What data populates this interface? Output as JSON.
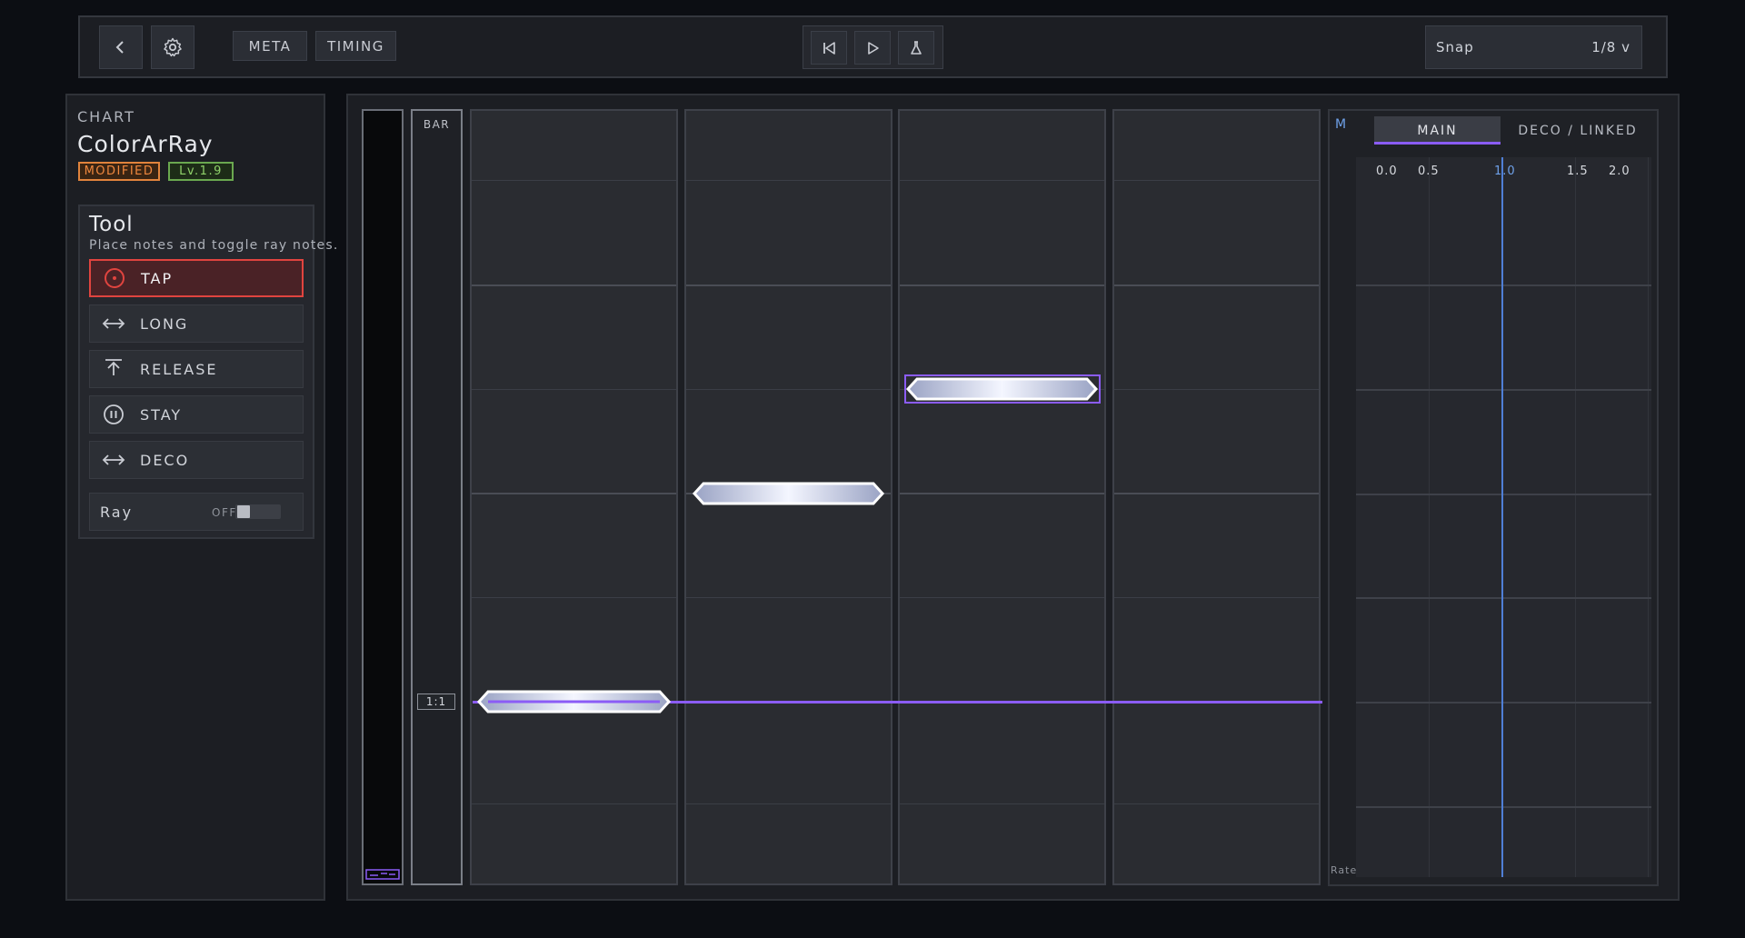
{
  "toolbar": {
    "meta_label": "META",
    "timing_label": "TIMING",
    "snap_label": "Snap",
    "snap_value": "1/8 v"
  },
  "sidebar": {
    "section_label": "CHART",
    "chart_title": "ColorArRay",
    "modified_tag": "MODIFIED",
    "level_tag": "Lv.1.9",
    "tool": {
      "title": "Tool",
      "description": "Place notes and toggle ray notes.",
      "items": [
        {
          "label": "TAP",
          "icon": "target-icon",
          "active": true
        },
        {
          "label": "LONG",
          "icon": "double-arrow-icon",
          "active": false
        },
        {
          "label": "RELEASE",
          "icon": "upload-icon",
          "active": false
        },
        {
          "label": "STAY",
          "icon": "pause-circle-icon",
          "active": false
        },
        {
          "label": "DECO",
          "icon": "double-arrow-icon",
          "active": false
        }
      ],
      "ray": {
        "label": "Ray",
        "state": "OFF"
      }
    }
  },
  "editor": {
    "bar_label": "BAR",
    "bar_marker": "1:1",
    "colors": {
      "accent": "#8b5cf6",
      "tap_active": "#e0443f",
      "modified": "#f0883e",
      "level": "#8fd16a",
      "cursor": "#4f7fd6"
    }
  },
  "rate_panel": {
    "m_label": "M",
    "tabs": [
      "MAIN",
      "DECO / LINKED"
    ],
    "active_tab": "MAIN",
    "ticks": [
      "0.0",
      "0.5",
      "1.0",
      "1.5",
      "2.0"
    ],
    "rate_label": "Rate"
  }
}
